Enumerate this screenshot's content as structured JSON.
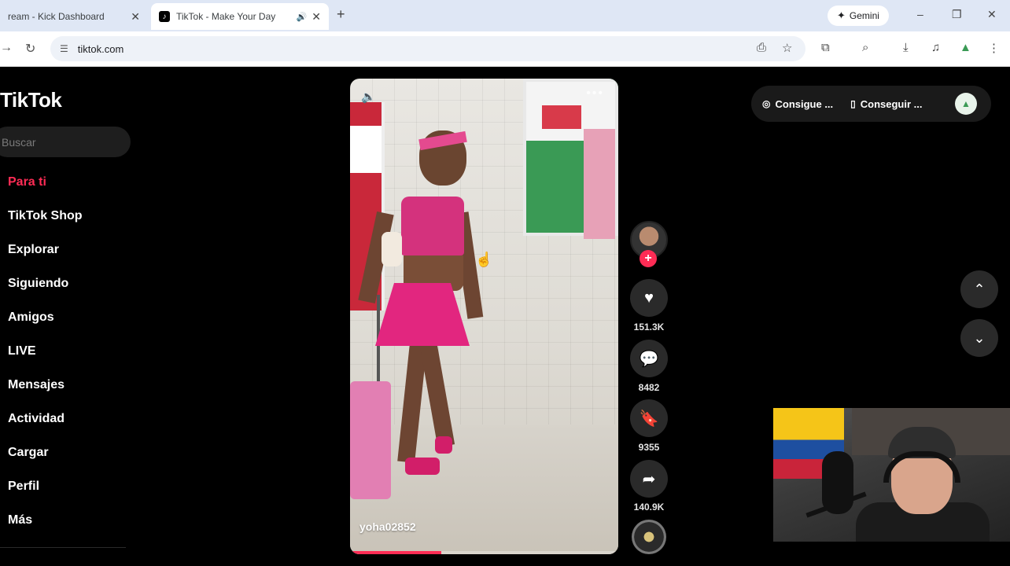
{
  "browser": {
    "tabs": [
      {
        "title": "ream - Kick Dashboard",
        "close": "✕"
      },
      {
        "title": "TikTok - Make Your Day",
        "close": "✕"
      }
    ],
    "new_tab": "+",
    "gemini_label": "Gemini",
    "url": "tiktok.com",
    "window_controls": [
      "–",
      "❐",
      "✕"
    ]
  },
  "tiktok": {
    "logo": "TikTok",
    "search_placeholder": "Buscar",
    "nav": [
      {
        "label": "Para ti",
        "active": true
      },
      {
        "label": "TikTok Shop"
      },
      {
        "label": "Explorar"
      },
      {
        "label": "Siguiendo"
      },
      {
        "label": "Amigos"
      },
      {
        "label": "LIVE"
      },
      {
        "label": "Mensajes"
      },
      {
        "label": "Actividad"
      },
      {
        "label": "Cargar"
      },
      {
        "label": "Perfil"
      },
      {
        "label": "Más"
      }
    ],
    "video": {
      "username": "yoha02852",
      "progress": 0.34
    },
    "actions": {
      "likes": "151.3K",
      "comments": "8482",
      "saves": "9355",
      "shares": "140.9K"
    },
    "top_right": {
      "item1": "Consigue ...",
      "item2": "Conseguir ..."
    },
    "colors": {
      "accent": "#fe2c55",
      "background": "#000000"
    }
  }
}
